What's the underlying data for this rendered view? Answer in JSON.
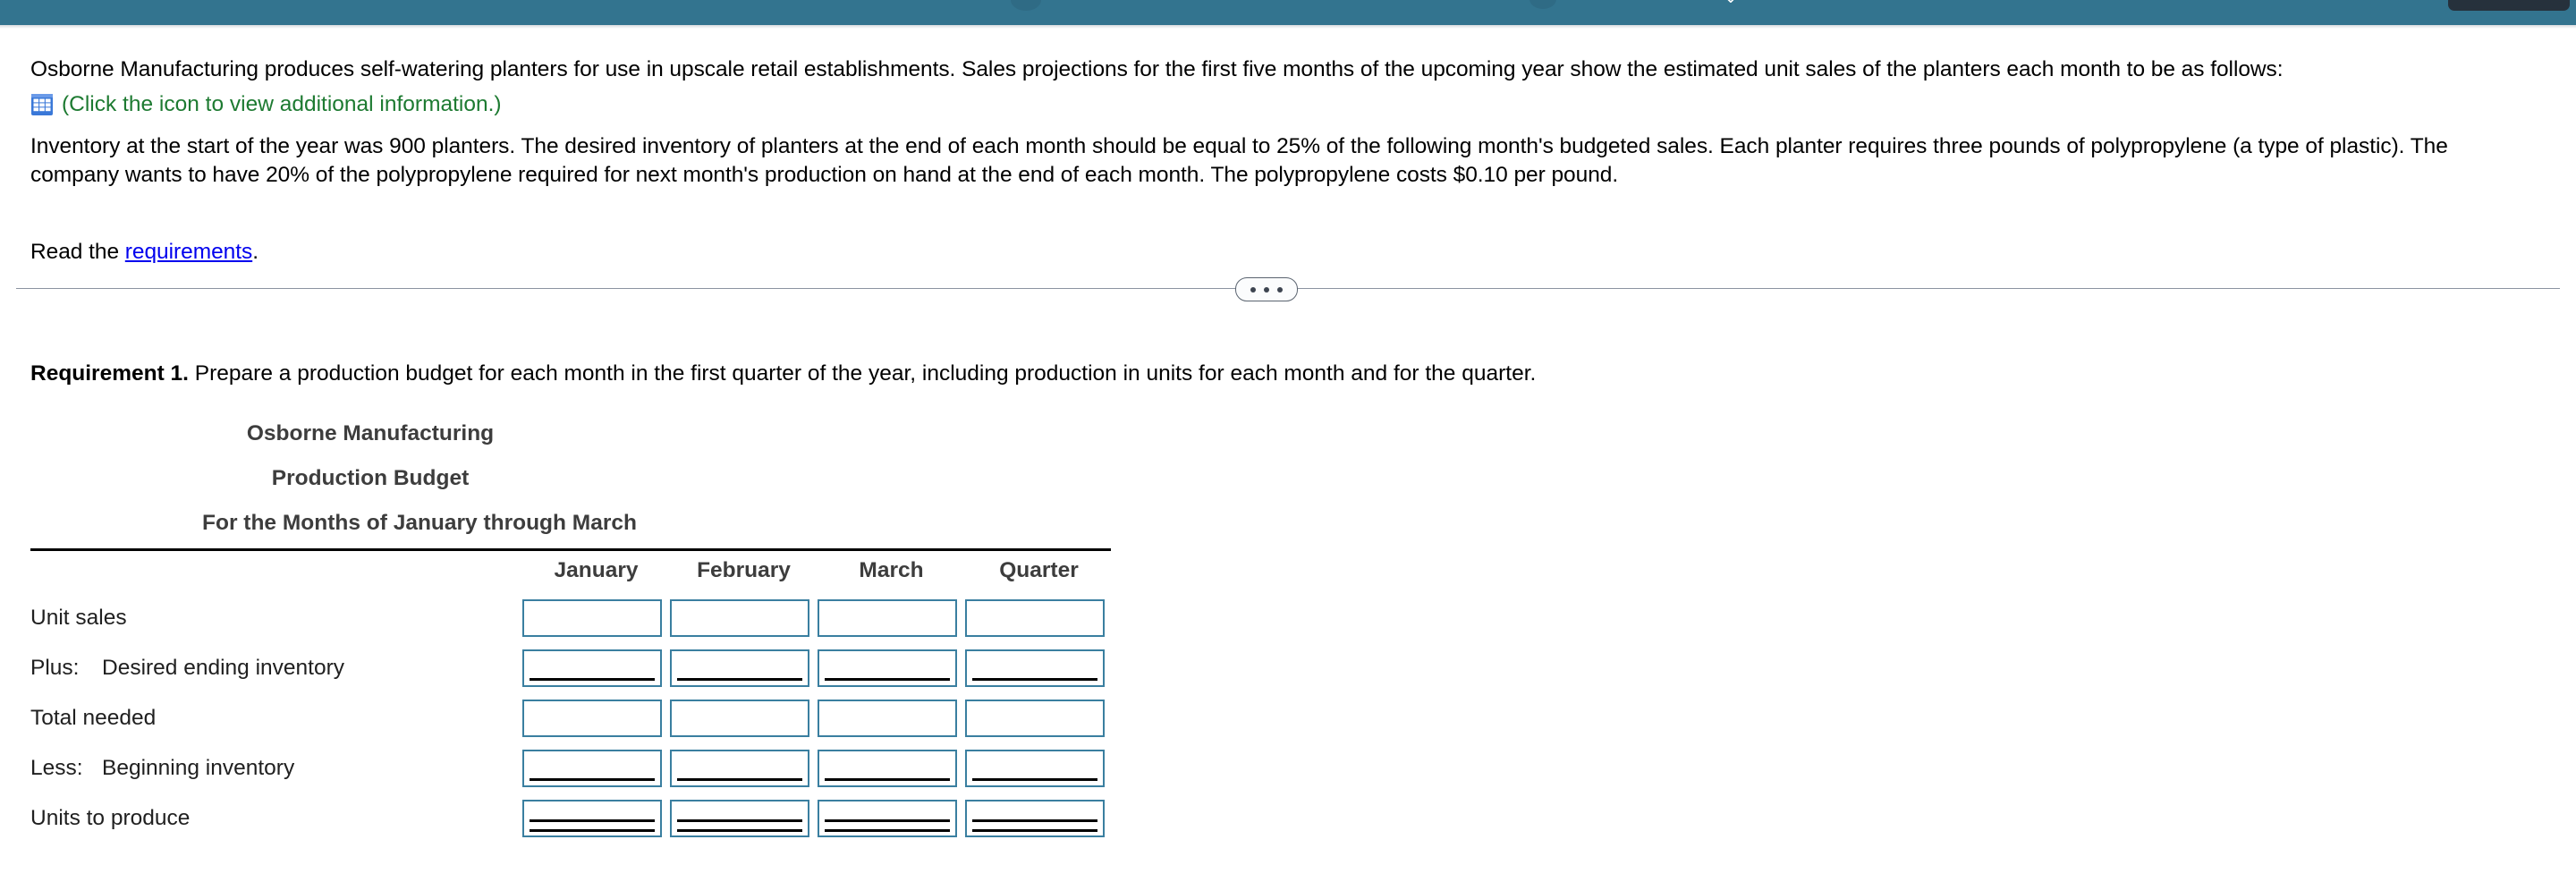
{
  "top_bar": {
    "accent_color": "#33748f",
    "button_color": "#26313c",
    "caret_glyph": "⌄"
  },
  "problem": {
    "paragraph_1": "Osborne Manufacturing produces self-watering planters for use in upscale retail establishments. Sales projections for the first five months of the upcoming year show the estimated unit sales of the planters each month to be as follows:",
    "icon_note": "(Click the icon to view additional information.)",
    "icon_note_color": "#1d7a31",
    "paragraph_2": "Inventory at the start of the year was 900 planters. The desired inventory of planters at the end of each month should be equal to 25% of the following month's budgeted sales. Each planter requires three pounds of polypropylene (a type of plastic). The company wants to have 20% of the polypropylene required for next month's production on hand at the end of each month. The polypropylene costs $0.10 per pound.",
    "read_prefix": "Read the ",
    "read_link": "requirements",
    "read_suffix": ".",
    "link_color": "#0000ee"
  },
  "requirement": {
    "label": "Requirement 1.",
    "text": " Prepare a production budget for each month in the first quarter of the year, including production in units for each month and for the quarter."
  },
  "budget": {
    "company": "Osborne Manufacturing",
    "statement": "Production Budget",
    "period": "For the Months of January through March",
    "columns": [
      "January",
      "February",
      "March",
      "Quarter"
    ],
    "rows": [
      {
        "lead": "",
        "label": "Unit sales",
        "rule": "none",
        "values": [
          "",
          "",
          "",
          ""
        ]
      },
      {
        "lead": "Plus:",
        "label": "Desired ending inventory",
        "rule": "single",
        "values": [
          "",
          "",
          "",
          ""
        ]
      },
      {
        "lead": "",
        "label": "Total needed",
        "rule": "none",
        "values": [
          "",
          "",
          "",
          ""
        ]
      },
      {
        "lead": "Less:",
        "label": "Beginning inventory",
        "rule": "single",
        "values": [
          "",
          "",
          "",
          ""
        ]
      },
      {
        "lead": "",
        "label": "Units to produce",
        "rule": "double",
        "values": [
          "",
          "",
          "",
          ""
        ]
      }
    ],
    "input_border_color": "#3a7fa0",
    "input_placeholder": ""
  }
}
